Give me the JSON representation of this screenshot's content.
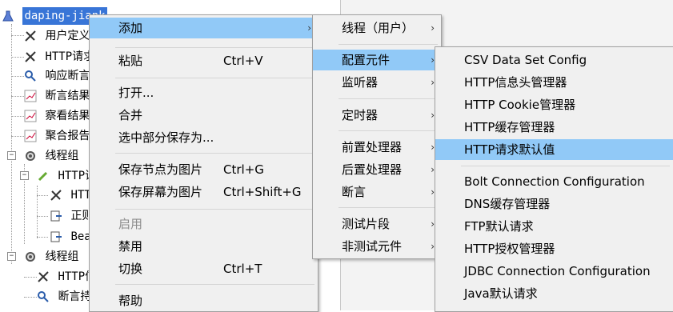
{
  "tree": {
    "root_label": "daping-jiank",
    "rows": [
      {
        "label": "用户定义"
      },
      {
        "label": "HTTP请求"
      },
      {
        "label": "响应断言"
      },
      {
        "label": "断言结果"
      },
      {
        "label": "察看结果"
      },
      {
        "label": "聚合报告"
      },
      {
        "label": "线程组"
      },
      {
        "label": "HTTP请"
      },
      {
        "label": "HTTP"
      },
      {
        "label": "正则"
      },
      {
        "label": "Bea"
      },
      {
        "label": "线程组"
      },
      {
        "label": "HTTP信息"
      },
      {
        "label": "断言持"
      }
    ]
  },
  "context_menu": {
    "items": [
      {
        "label": "添加",
        "submenu": true,
        "highlighted": true
      },
      {
        "label": "粘贴",
        "shortcut": "Ctrl+V"
      },
      {
        "label": "打开..."
      },
      {
        "label": "合并"
      },
      {
        "label": "选中部分保存为..."
      },
      {
        "label": "保存节点为图片",
        "shortcut": "Ctrl+G"
      },
      {
        "label": "保存屏幕为图片",
        "shortcut": "Ctrl+Shift+G"
      },
      {
        "label": "启用",
        "disabled": true
      },
      {
        "label": "禁用"
      },
      {
        "label": "切换",
        "shortcut": "Ctrl+T"
      },
      {
        "label": "帮助"
      }
    ]
  },
  "add_submenu": {
    "items": [
      {
        "label": "线程（用户）"
      },
      {
        "label": "配置元件"
      },
      {
        "label": "监听器"
      },
      {
        "label": "定时器"
      },
      {
        "label": "前置处理器"
      },
      {
        "label": "后置处理器"
      },
      {
        "label": "断言"
      },
      {
        "label": "测试片段"
      },
      {
        "label": "非测试元件"
      }
    ]
  },
  "config_submenu": {
    "items": [
      {
        "label": "CSV Data Set Config"
      },
      {
        "label": "HTTP信息头管理器"
      },
      {
        "label": "HTTP Cookie管理器"
      },
      {
        "label": "HTTP缓存管理器"
      },
      {
        "label": "HTTP请求默认值"
      },
      {
        "label": "Bolt Connection Configuration"
      },
      {
        "label": "DNS缓存管理器"
      },
      {
        "label": "FTP默认请求"
      },
      {
        "label": "HTTP授权管理器"
      },
      {
        "label": "JDBC Connection Configuration"
      },
      {
        "label": "Java默认请求"
      }
    ]
  },
  "colors": {
    "selection": "#3875d7",
    "menu_highlight": "#91c9f7",
    "menu_bg": "#f0f0f0"
  }
}
